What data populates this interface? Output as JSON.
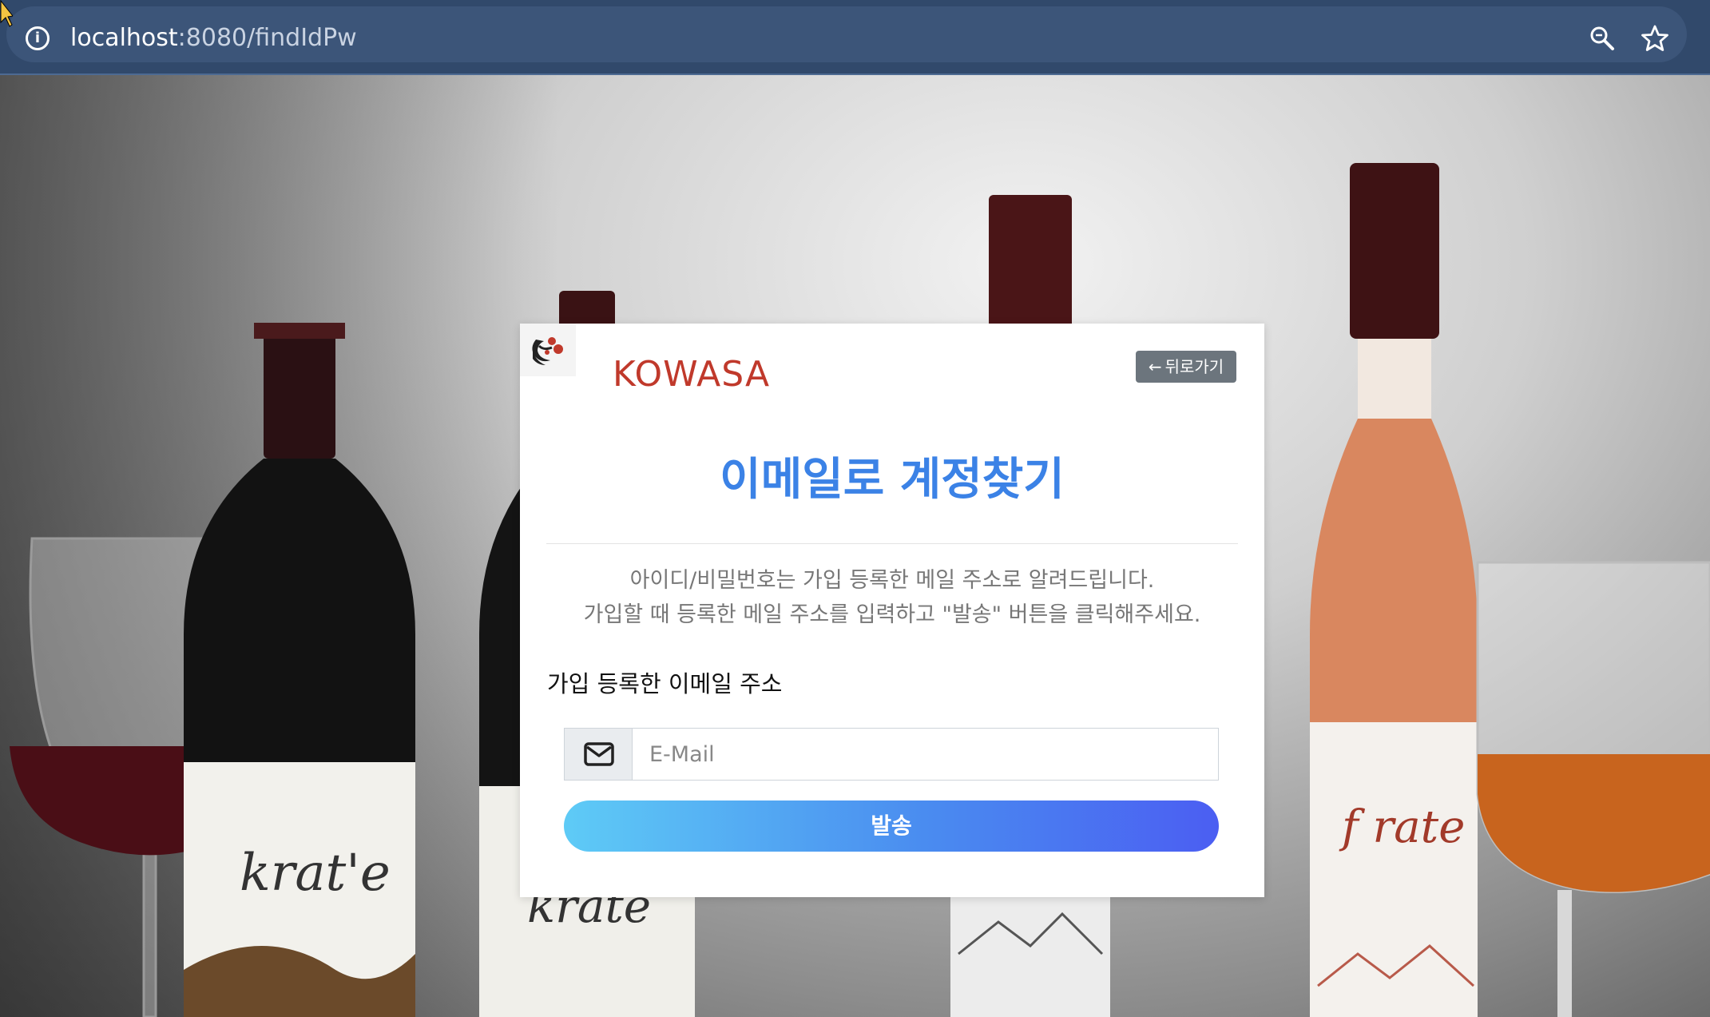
{
  "browser": {
    "url_host": "localhost",
    "url_rest": ":8080/findIdPw"
  },
  "card": {
    "brand": "KOWASA",
    "back_label": "뒤로가기",
    "title": "이메일로 계정찾기",
    "desc_line1": "아이디/비밀번호는 가입 등록한 메일 주소로 알려드립니다.",
    "desc_line2": "가입할 때 등록한 메일 주소를 입력하고 \"발송\" 버튼을 클릭해주세요.",
    "email_label": "가입 등록한 이메일 주소",
    "email_placeholder": "E-Mail",
    "email_value": "",
    "send_label": "발송"
  },
  "colors": {
    "title": "#3b82e6",
    "brand": "#c0392b",
    "back_button": "#6c757d",
    "addressbar": "#31496b"
  },
  "icons": {
    "info": "info-icon",
    "zoom": "zoom-icon",
    "star": "bookmark-star-icon",
    "back_arrow": "arrow-left-icon",
    "envelope": "envelope-icon",
    "logo": "kowasa-logo-icon"
  }
}
